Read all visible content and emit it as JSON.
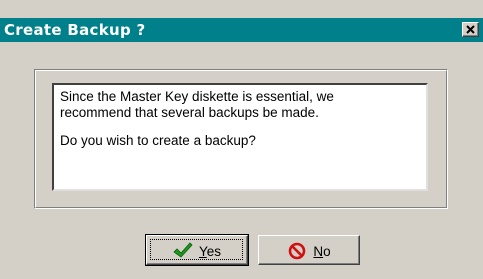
{
  "dialog": {
    "title": "Create Backup ?",
    "message_lines": [
      "Since the Master Key diskette is essential, we",
      "recommend that several backups be made.",
      "Do you wish to create a backup?"
    ]
  },
  "buttons": {
    "yes": {
      "mnemonic": "Y",
      "rest": "es",
      "icon": "green-checkmark-icon"
    },
    "no": {
      "mnemonic": "N",
      "rest": "o",
      "icon": "red-no-entry-icon"
    }
  },
  "colors": {
    "title_bar": "#00808a",
    "window_bg": "#d4d0c8",
    "check_green": "#1a9a1a",
    "no_red": "#d01010"
  },
  "icons": {
    "close": "close-x-icon"
  }
}
